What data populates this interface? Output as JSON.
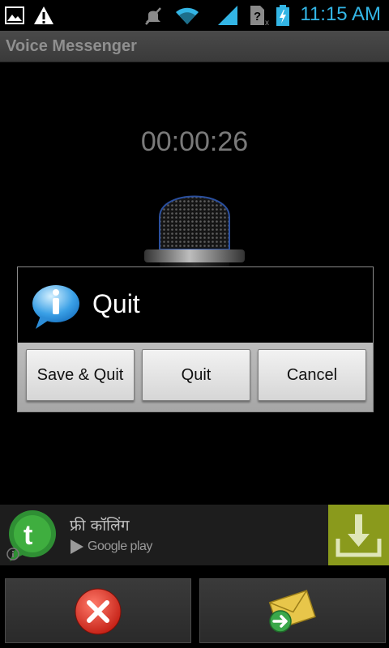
{
  "status_bar": {
    "time": "11:15 AM",
    "icons": [
      "image-icon",
      "warning-icon",
      "mute-icon",
      "wifi-icon",
      "signal-icon",
      "sim-unknown-icon",
      "battery-charging-icon"
    ]
  },
  "app": {
    "title": "Voice Messenger"
  },
  "recorder": {
    "elapsed": "00:00:26"
  },
  "dialog": {
    "title": "Quit",
    "icon": "info-icon",
    "buttons": {
      "save_quit": "Save & Quit",
      "quit": "Quit",
      "cancel": "Cancel"
    }
  },
  "ad": {
    "text": "फ्री कॉलिंग",
    "store_label": "Google play",
    "icons": [
      "app-logo-icon",
      "ad-info-icon",
      "download-icon"
    ]
  },
  "bottom_bar": {
    "icons": [
      "discard-icon",
      "send-message-icon"
    ]
  },
  "colors": {
    "accent": "#33b5e5",
    "ad_download_bg": "#8a9a1c",
    "discard_red": "#d32a1e"
  }
}
